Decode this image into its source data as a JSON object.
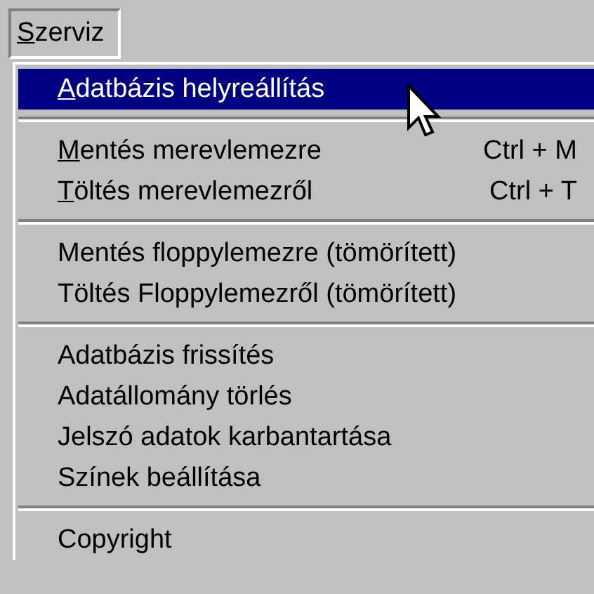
{
  "menu_bar": {
    "title": {
      "label": "Szerviz",
      "underline_first": true,
      "open": true
    }
  },
  "menu": [
    {
      "kind": "item",
      "label": "Adatbázis helyreállítás",
      "underline_first": true,
      "selected": true
    },
    {
      "kind": "separator"
    },
    {
      "kind": "item",
      "label": "Mentés merevlemezre",
      "shortcut": "Ctrl + M",
      "underline_first": true,
      "selected": false
    },
    {
      "kind": "item",
      "label": "Töltés merevlemezről",
      "shortcut": "Ctrl + T",
      "underline_first": true,
      "selected": false
    },
    {
      "kind": "separator"
    },
    {
      "kind": "item",
      "label": "Mentés floppylemezre (tömörített)",
      "underline_first": false,
      "selected": false
    },
    {
      "kind": "item",
      "label": "Töltés Floppylemezről (tömörített)",
      "underline_first": false,
      "selected": false
    },
    {
      "kind": "separator"
    },
    {
      "kind": "item",
      "label": "Adatbázis frissítés",
      "underline_first": false,
      "selected": false
    },
    {
      "kind": "item",
      "label": "Adatállomány törlés",
      "underline_first": false,
      "selected": false
    },
    {
      "kind": "item",
      "label": "Jelszó adatok karbantartása",
      "underline_first": false,
      "selected": false
    },
    {
      "kind": "item",
      "label": "Színek beállítása",
      "underline_first": false,
      "selected": false
    },
    {
      "kind": "separator"
    },
    {
      "kind": "item",
      "label": "Copyright",
      "underline_first": false,
      "selected": false
    }
  ]
}
